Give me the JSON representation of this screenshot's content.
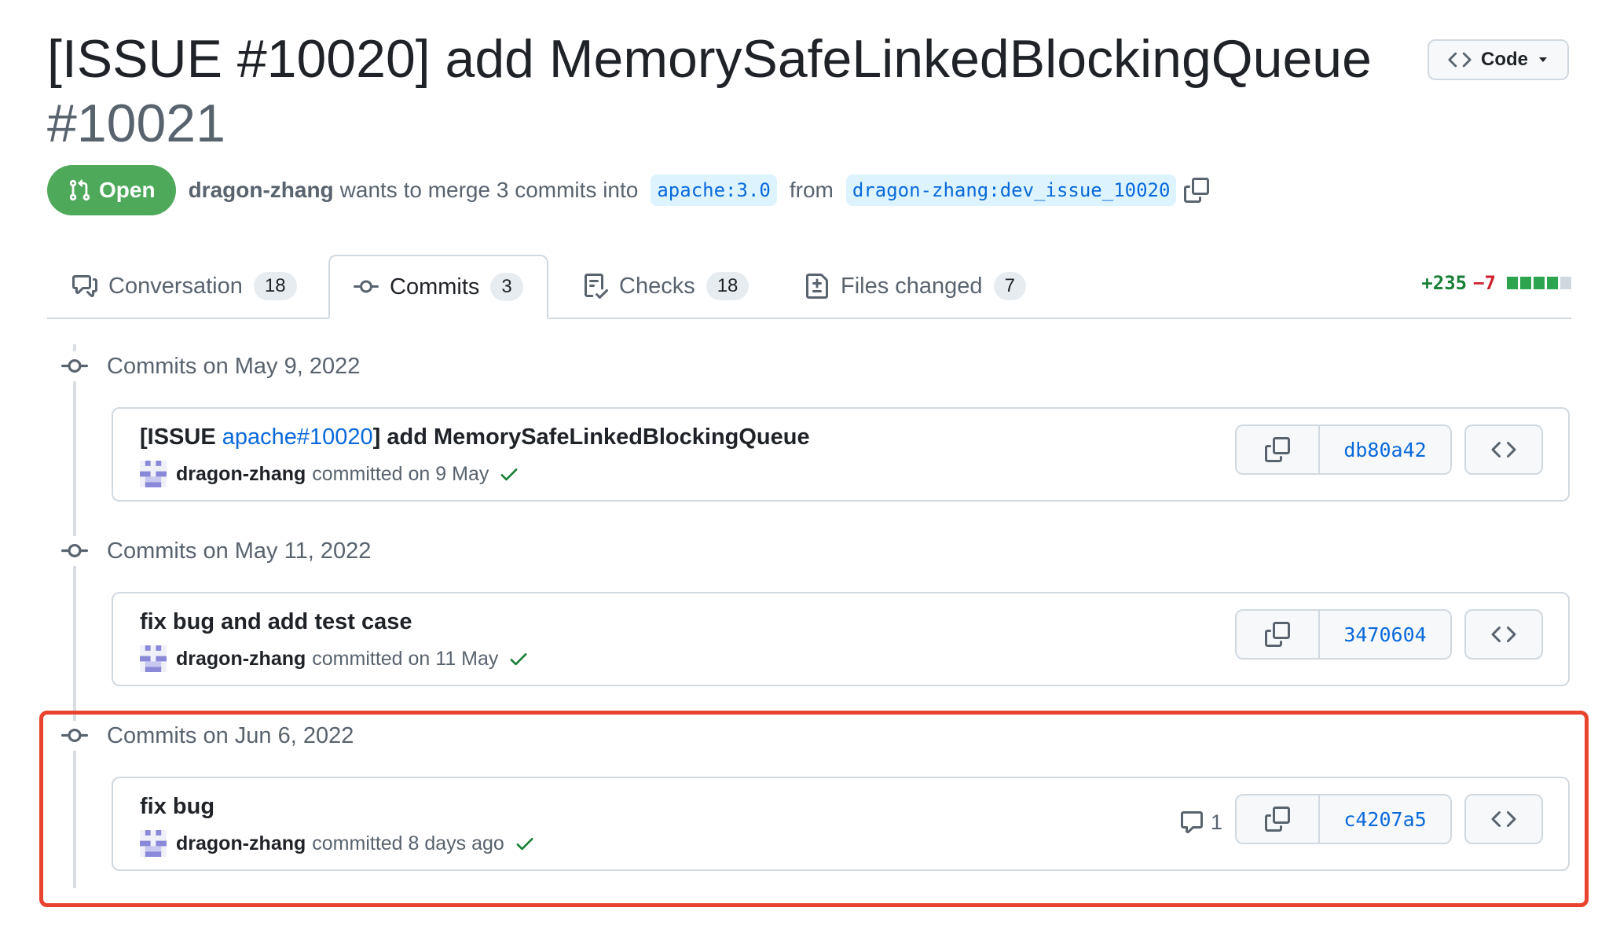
{
  "title": {
    "text": "[ISSUE #10020] add MemorySafeLinkedBlockingQueue",
    "number": "#10021"
  },
  "code_button": {
    "label": "Code"
  },
  "status": {
    "state": "Open",
    "author": "dragon-zhang",
    "merge_text": "wants to merge 3 commits into",
    "base_branch": "apache:3.0",
    "from_text": "from",
    "head_branch": "dragon-zhang:dev_issue_10020"
  },
  "tabs": [
    {
      "label": "Conversation",
      "count": "18",
      "icon": "comment-discussion-icon"
    },
    {
      "label": "Commits",
      "count": "3",
      "icon": "git-commit-icon"
    },
    {
      "label": "Checks",
      "count": "18",
      "icon": "checklist-icon"
    },
    {
      "label": "Files changed",
      "count": "7",
      "icon": "file-diff-icon"
    }
  ],
  "diffstat": {
    "additions": "+235",
    "deletions": "−7"
  },
  "groups": [
    {
      "date_label": "Commits on May 9, 2022",
      "commit": {
        "msg_prefix": "[ISSUE ",
        "msg_link": "apache#10020",
        "msg_suffix": "] add MemorySafeLinkedBlockingQueue",
        "author": "dragon-zhang",
        "committed": "committed on 9 May",
        "sha": "db80a42"
      }
    },
    {
      "date_label": "Commits on May 11, 2022",
      "commit": {
        "msg": "fix bug and add test case",
        "author": "dragon-zhang",
        "committed": "committed on 11 May",
        "sha": "3470604"
      }
    },
    {
      "date_label": "Commits on Jun 6, 2022",
      "commit": {
        "msg": "fix bug",
        "author": "dragon-zhang",
        "committed": "committed 8 days ago",
        "sha": "c4207a5",
        "comments": "1"
      }
    }
  ],
  "colors": {
    "open_badge": "#4fa95b",
    "link": "#0969da",
    "highlight_border": "#e8432f",
    "additions": "#1a7f37",
    "deletions": "#cf222e"
  }
}
